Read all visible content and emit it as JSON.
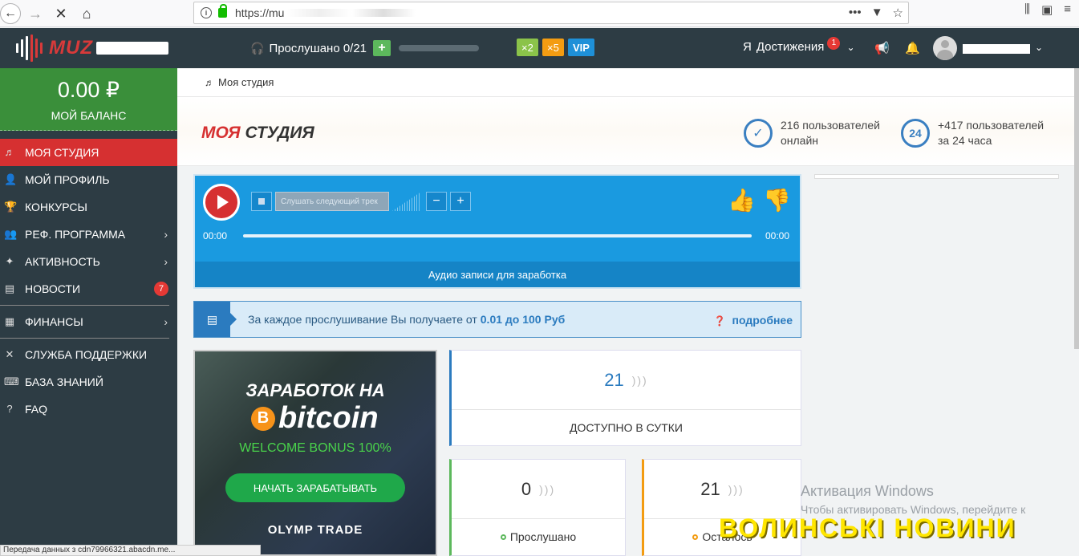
{
  "browser": {
    "url_prefix": "https://mu"
  },
  "header": {
    "logo_text": "MUZ",
    "listened_label": "Прослушано 0/21",
    "plus_label": "+",
    "multipliers": [
      {
        "label": "×2"
      },
      {
        "label": "×5"
      },
      {
        "label": "VIP"
      }
    ],
    "achievements_label": "Достижения",
    "achievements_badge": "1"
  },
  "sidebar": {
    "balance_amount": "0.00 ₽",
    "balance_label": "МОЙ БАЛАНС",
    "items": [
      {
        "label": "МОЯ СТУДИЯ"
      },
      {
        "label": "МОЙ ПРОФИЛЬ"
      },
      {
        "label": "КОНКУРСЫ"
      },
      {
        "label": "РЕФ. ПРОГРАММА"
      },
      {
        "label": "АКТИВНОСТЬ"
      },
      {
        "label": "НОВОСТИ",
        "badge": "7"
      },
      {
        "label": "ФИНАНСЫ"
      },
      {
        "label": "СЛУЖБА ПОДДЕРЖКИ"
      },
      {
        "label": "БАЗА ЗНАНИЙ"
      },
      {
        "label": "FAQ"
      }
    ]
  },
  "breadcrumb": {
    "label": "Моя студия"
  },
  "title": {
    "part1": "МОЯ",
    "part2": "СТУДИЯ"
  },
  "stats": {
    "online_line1": "216 пользователей",
    "online_line2": "онлайн",
    "day_icon": "24",
    "day_line1": "+417 пользователей",
    "day_line2": "за 24 часа"
  },
  "player": {
    "next_track_label": "Слушать следующий трек",
    "minus": "−",
    "plus": "+",
    "time_start": "00:00",
    "time_end": "00:00",
    "caption": "Аудио записи для заработка"
  },
  "info": {
    "text": "За каждое прослушивание Вы получаете от",
    "range": "0.01 до 100 Руб",
    "more": "подробнее"
  },
  "ad": {
    "title": "ЗАРАБОТОК НА",
    "coin": "B",
    "btc": "bitcoin",
    "bonus": "WELCOME BONUS 100%",
    "button": "НАЧАТЬ ЗАРАБАТЫВАТЬ",
    "brand": "OLYMP TRADE"
  },
  "cards": {
    "daily_value": "21",
    "daily_label": "ДОСТУПНО В СУТКИ",
    "listened_value": "0",
    "listened_label": "Прослушано",
    "remaining_value": "21",
    "remaining_label": "Осталось"
  },
  "overlay": {
    "win_activation": "Активация Windows",
    "win_activation_sub": "Чтобы активировать Windows, перейдите к",
    "news_watermark": "ВОЛИНСЬКІ НОВИНИ",
    "status_text": "Передача данных з cdn79966321.abacdn.me..."
  },
  "colors": {
    "header_bg": "#2d3c44",
    "balance_bg": "#3a8f3a",
    "active_red": "#d63031",
    "player_blue": "#1a9ae0"
  }
}
